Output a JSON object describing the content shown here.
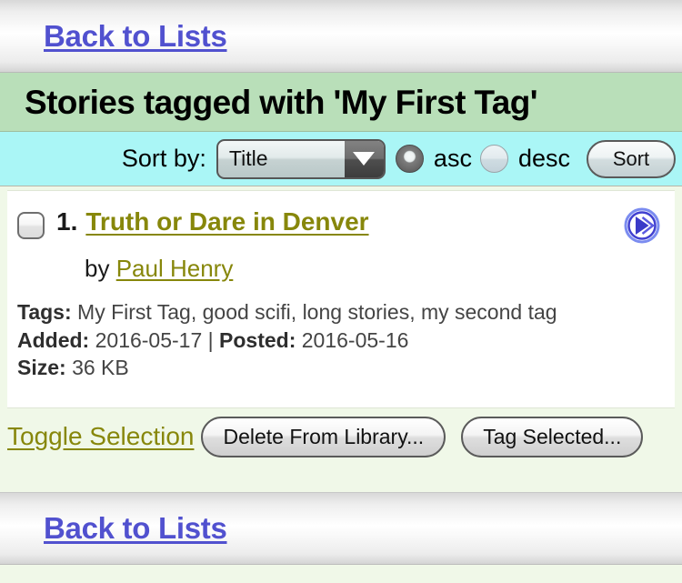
{
  "nav": {
    "back_top_label": "Back to Lists",
    "back_bottom_label": "Back to Lists"
  },
  "heading": {
    "title": "Stories tagged with 'My First Tag'"
  },
  "sortbar": {
    "label": "Sort by:",
    "select_value": "Title",
    "select_options": [
      "Title"
    ],
    "asc_label": "asc",
    "desc_label": "desc",
    "asc_selected": true,
    "desc_selected": false,
    "sort_button_label": "Sort"
  },
  "story": {
    "index": "1.",
    "title": "Truth or Dare in Denver",
    "by_prefix": "by",
    "author": "Paul Henry",
    "checkbox_checked": false,
    "tags_label": "Tags:",
    "tags_value": "My First Tag, good scifi, long stories, my second tag",
    "added_label": "Added:",
    "added_value": "2016-05-17",
    "separator": "|",
    "posted_label": "Posted:",
    "posted_value": "2016-05-16",
    "size_label": "Size:",
    "size_value": "36 KB"
  },
  "actions": {
    "toggle_label": "Toggle Selection",
    "delete_label": "Delete From Library...",
    "tag_label": "Tag Selected..."
  },
  "colors": {
    "link_blue": "#5151cf",
    "link_olive": "#87870b",
    "heading_band": "#b9dfb9",
    "sortbar_cyan": "#aaf6f6",
    "page_bg": "#f0f8e8",
    "go_icon_blue": "#4040d0"
  }
}
